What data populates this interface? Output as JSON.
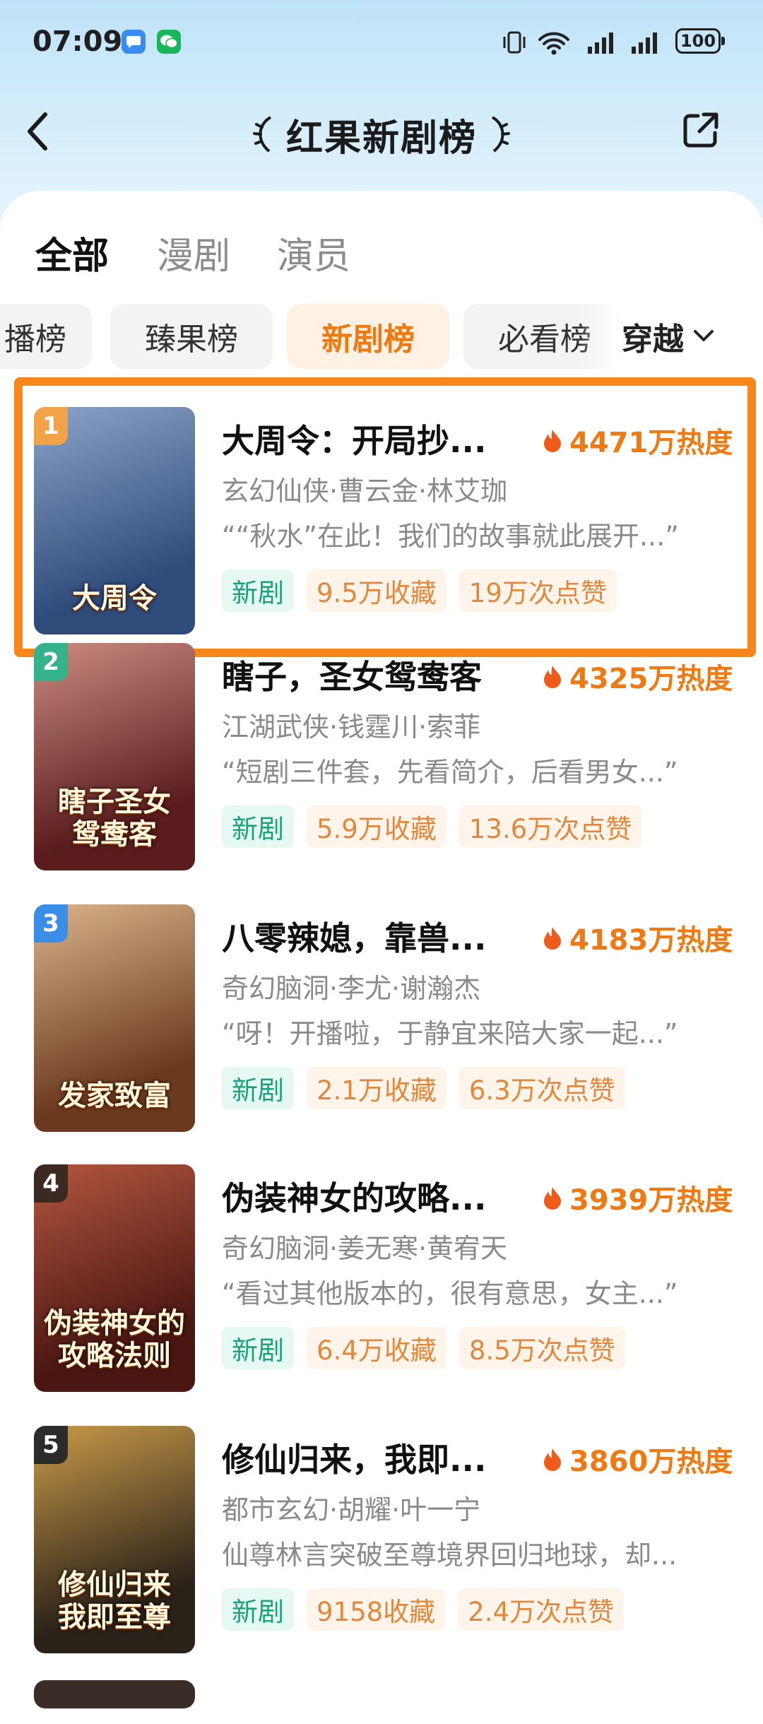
{
  "status_bar": {
    "time": "07:09",
    "battery": "100"
  },
  "header": {
    "title": "红果新剧榜"
  },
  "main_tabs": [
    {
      "label": "全部",
      "active": true
    },
    {
      "label": "漫剧",
      "active": false
    },
    {
      "label": "演员",
      "active": false
    }
  ],
  "sub_tabs": [
    {
      "label": "播榜",
      "active": false
    },
    {
      "label": "臻果榜",
      "active": false
    },
    {
      "label": "新剧榜",
      "active": true
    },
    {
      "label": "必看榜",
      "active": false
    }
  ],
  "genre_filter": {
    "label": "穿越"
  },
  "dramas": [
    {
      "rank": "1",
      "title": "大周令：开局抄...",
      "heat": "4471万热度",
      "meta": "玄幻仙侠·曹云金·林艾珈",
      "quote": "““秋水”在此！我们的故事就此展开...”",
      "tag_new": "新剧",
      "favorites": "9.5万收藏",
      "likes": "19万次点赞",
      "poster_text": "大周令",
      "rank_color": "#f2a347",
      "poster_colors": [
        "#2f4b7a",
        "#8aa3c8"
      ]
    },
    {
      "rank": "2",
      "title": "瞎子，圣女鸳鸯客",
      "heat": "4325万热度",
      "meta": "江湖武侠·钱霆川·索菲",
      "quote": "“短剧三件套，先看简介，后看男女...”",
      "tag_new": "新剧",
      "favorites": "5.9万收藏",
      "likes": "13.6万次点赞",
      "poster_text": "瞎子圣女 鸳鸯客",
      "rank_color": "#33b28c",
      "poster_colors": [
        "#5a1c1c",
        "#c98b80"
      ]
    },
    {
      "rank": "3",
      "title": "八零辣媳，靠兽...",
      "heat": "4183万热度",
      "meta": "奇幻脑洞·李尤·谢瀚杰",
      "quote": "“呀！开播啦，于静宜来陪大家一起...”",
      "tag_new": "新剧",
      "favorites": "2.1万收藏",
      "likes": "6.3万次点赞",
      "poster_text": "发家致富",
      "rank_color": "#3b8ee8",
      "poster_colors": [
        "#6b3a1e",
        "#d9b38a"
      ]
    },
    {
      "rank": "4",
      "title": "伪装神女的攻略...",
      "heat": "3939万热度",
      "meta": "奇幻脑洞·姜无寒·黄宥天",
      "quote": "“看过其他版本的，很有意思，女主...”",
      "tag_new": "新剧",
      "favorites": "6.4万收藏",
      "likes": "8.5万次点赞",
      "poster_text": "伪装神女的 攻略法则",
      "rank_color": "#3a2a22",
      "poster_colors": [
        "#4a1612",
        "#b2563f"
      ]
    },
    {
      "rank": "5",
      "title": "修仙归来，我即...",
      "heat": "3860万热度",
      "meta": "都市玄幻·胡耀·叶一宁",
      "quote": "仙尊林言突破至尊境界回归地球，却...",
      "tag_new": "新剧",
      "favorites": "9158收藏",
      "likes": "2.4万次点赞",
      "poster_text": "修仙归来 我即至尊",
      "rank_color": "#2b2b2b",
      "poster_colors": [
        "#2a2118",
        "#c89a4a"
      ]
    }
  ],
  "colors": {
    "accent": "#ef7a12",
    "highlight_border": "#f7861b",
    "new_tag": "#1aa37a"
  }
}
